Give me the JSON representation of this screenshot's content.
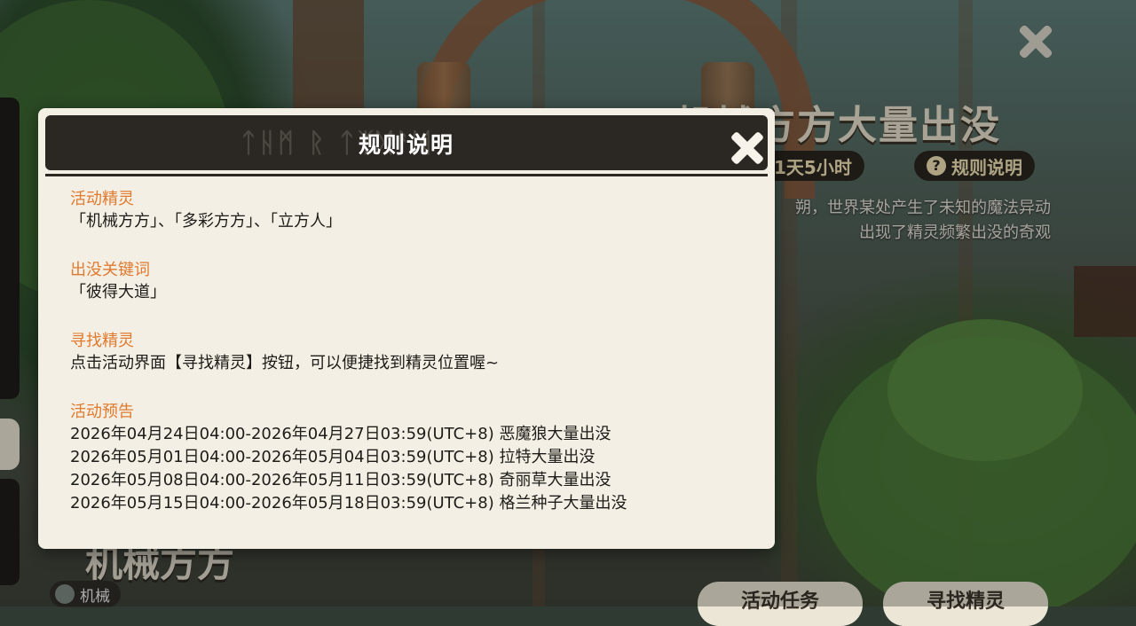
{
  "background": {
    "event_title": "机械方方大量出没",
    "timer_label": "1天5小时",
    "rules_button_label": "规则说明",
    "rules_button_icon": "question-icon",
    "description_lines": [
      "朔，世界某处产生了未知的魔法异动",
      "出现了精灵频繁出没的奇观"
    ],
    "pet_name": "机械方方",
    "pet_type": "机械",
    "bottom_buttons": [
      "活动任务",
      "寻找精灵"
    ]
  },
  "modal": {
    "header_runes": "ᛏᚺᛗ ᚱ ᛏᛉᛞᚨᛞ",
    "title": "规则说明",
    "close_icon": "close-icon",
    "sections": [
      {
        "heading": "活动精灵",
        "lines": [
          "「机械方方」、「多彩方方」、「立方人」"
        ]
      },
      {
        "heading": "出没关键词",
        "lines": [
          "「彼得大道」"
        ]
      },
      {
        "heading": "寻找精灵",
        "lines": [
          "点击活动界面【寻找精灵】按钮，可以便捷找到精灵位置喔~"
        ]
      },
      {
        "heading": "活动预告",
        "lines": [
          "2026年04月24日04:00-2026年04月27日03:59(UTC+8) 恶魔狼大量出没",
          "2026年05月01日04:00-2026年05月04日03:59(UTC+8) 拉特大量出没",
          "2026年05月08日04:00-2026年05月11日03:59(UTC+8) 奇丽草大量出没",
          "2026年05月15日04:00-2026年05月18日03:59(UTC+8) 格兰种子大量出没"
        ]
      }
    ]
  },
  "colors": {
    "section_heading": "#e07a2e",
    "modal_bg": "#f4efe4",
    "header_bg": "#2b2824"
  }
}
